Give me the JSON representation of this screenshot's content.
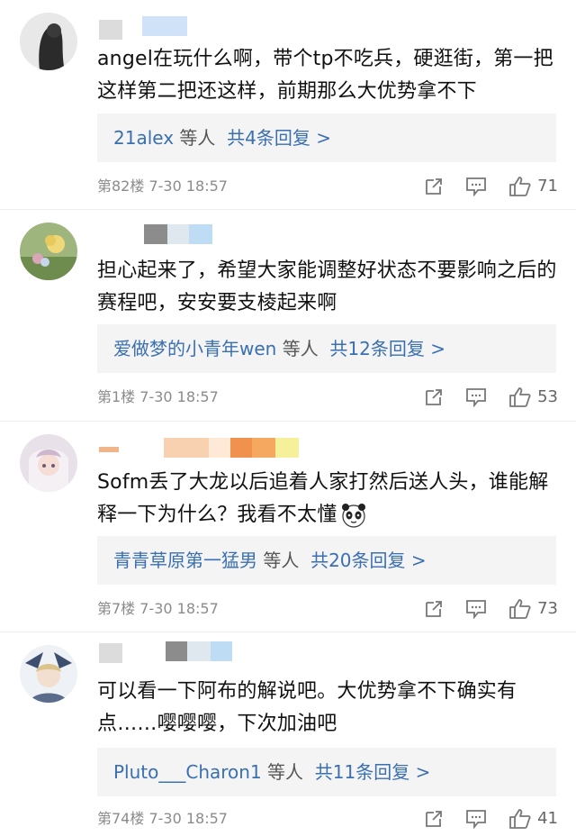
{
  "comments": [
    {
      "text": "angel在玩什么啊，带个tp不吃兵，硬逛街，第一把这样第二把还这样，前期那么大优势拿不下",
      "reply_users": "21alex",
      "reply_suffix": " 等人  ",
      "reply_count": "共4条回复 >",
      "floor": "第82楼  7-30 18:57",
      "likes": "71"
    },
    {
      "text": "担心起来了，希望大家能调整好状态不要影响之后的赛程吧，安安要支棱起来啊",
      "reply_users": "爱做梦的小青年wen",
      "reply_suffix": " 等人  ",
      "reply_count": "共12条回复 >",
      "floor": "第1楼  7-30 18:57",
      "likes": "53"
    },
    {
      "text": "Sofm丢了大龙以后追着人家打然后送人头，谁能解释一下为什么？我看不太懂",
      "reply_users": "青青草原第一猛男",
      "reply_suffix": " 等人  ",
      "reply_count": "共20条回复 >",
      "floor": "第7楼  7-30 18:57",
      "likes": "73"
    },
    {
      "text": "可以看一下阿布的解说吧。大优势拿不下确实有点……嘤嘤嘤，下次加油吧",
      "reply_users": "Pluto___Charon1",
      "reply_suffix": " 等人  ",
      "reply_count": "共11条回复 >",
      "floor": "第74楼  7-30 18:57",
      "likes": "41"
    }
  ],
  "icons": {
    "share": "share-icon",
    "comment": "comment-icon",
    "like": "thumbs-up-icon",
    "emoji": "panda-emoji-icon"
  },
  "colors": {
    "link": "#3a6fb1",
    "reply_bg": "#f4f4f4",
    "meta": "#8b8b8b"
  }
}
